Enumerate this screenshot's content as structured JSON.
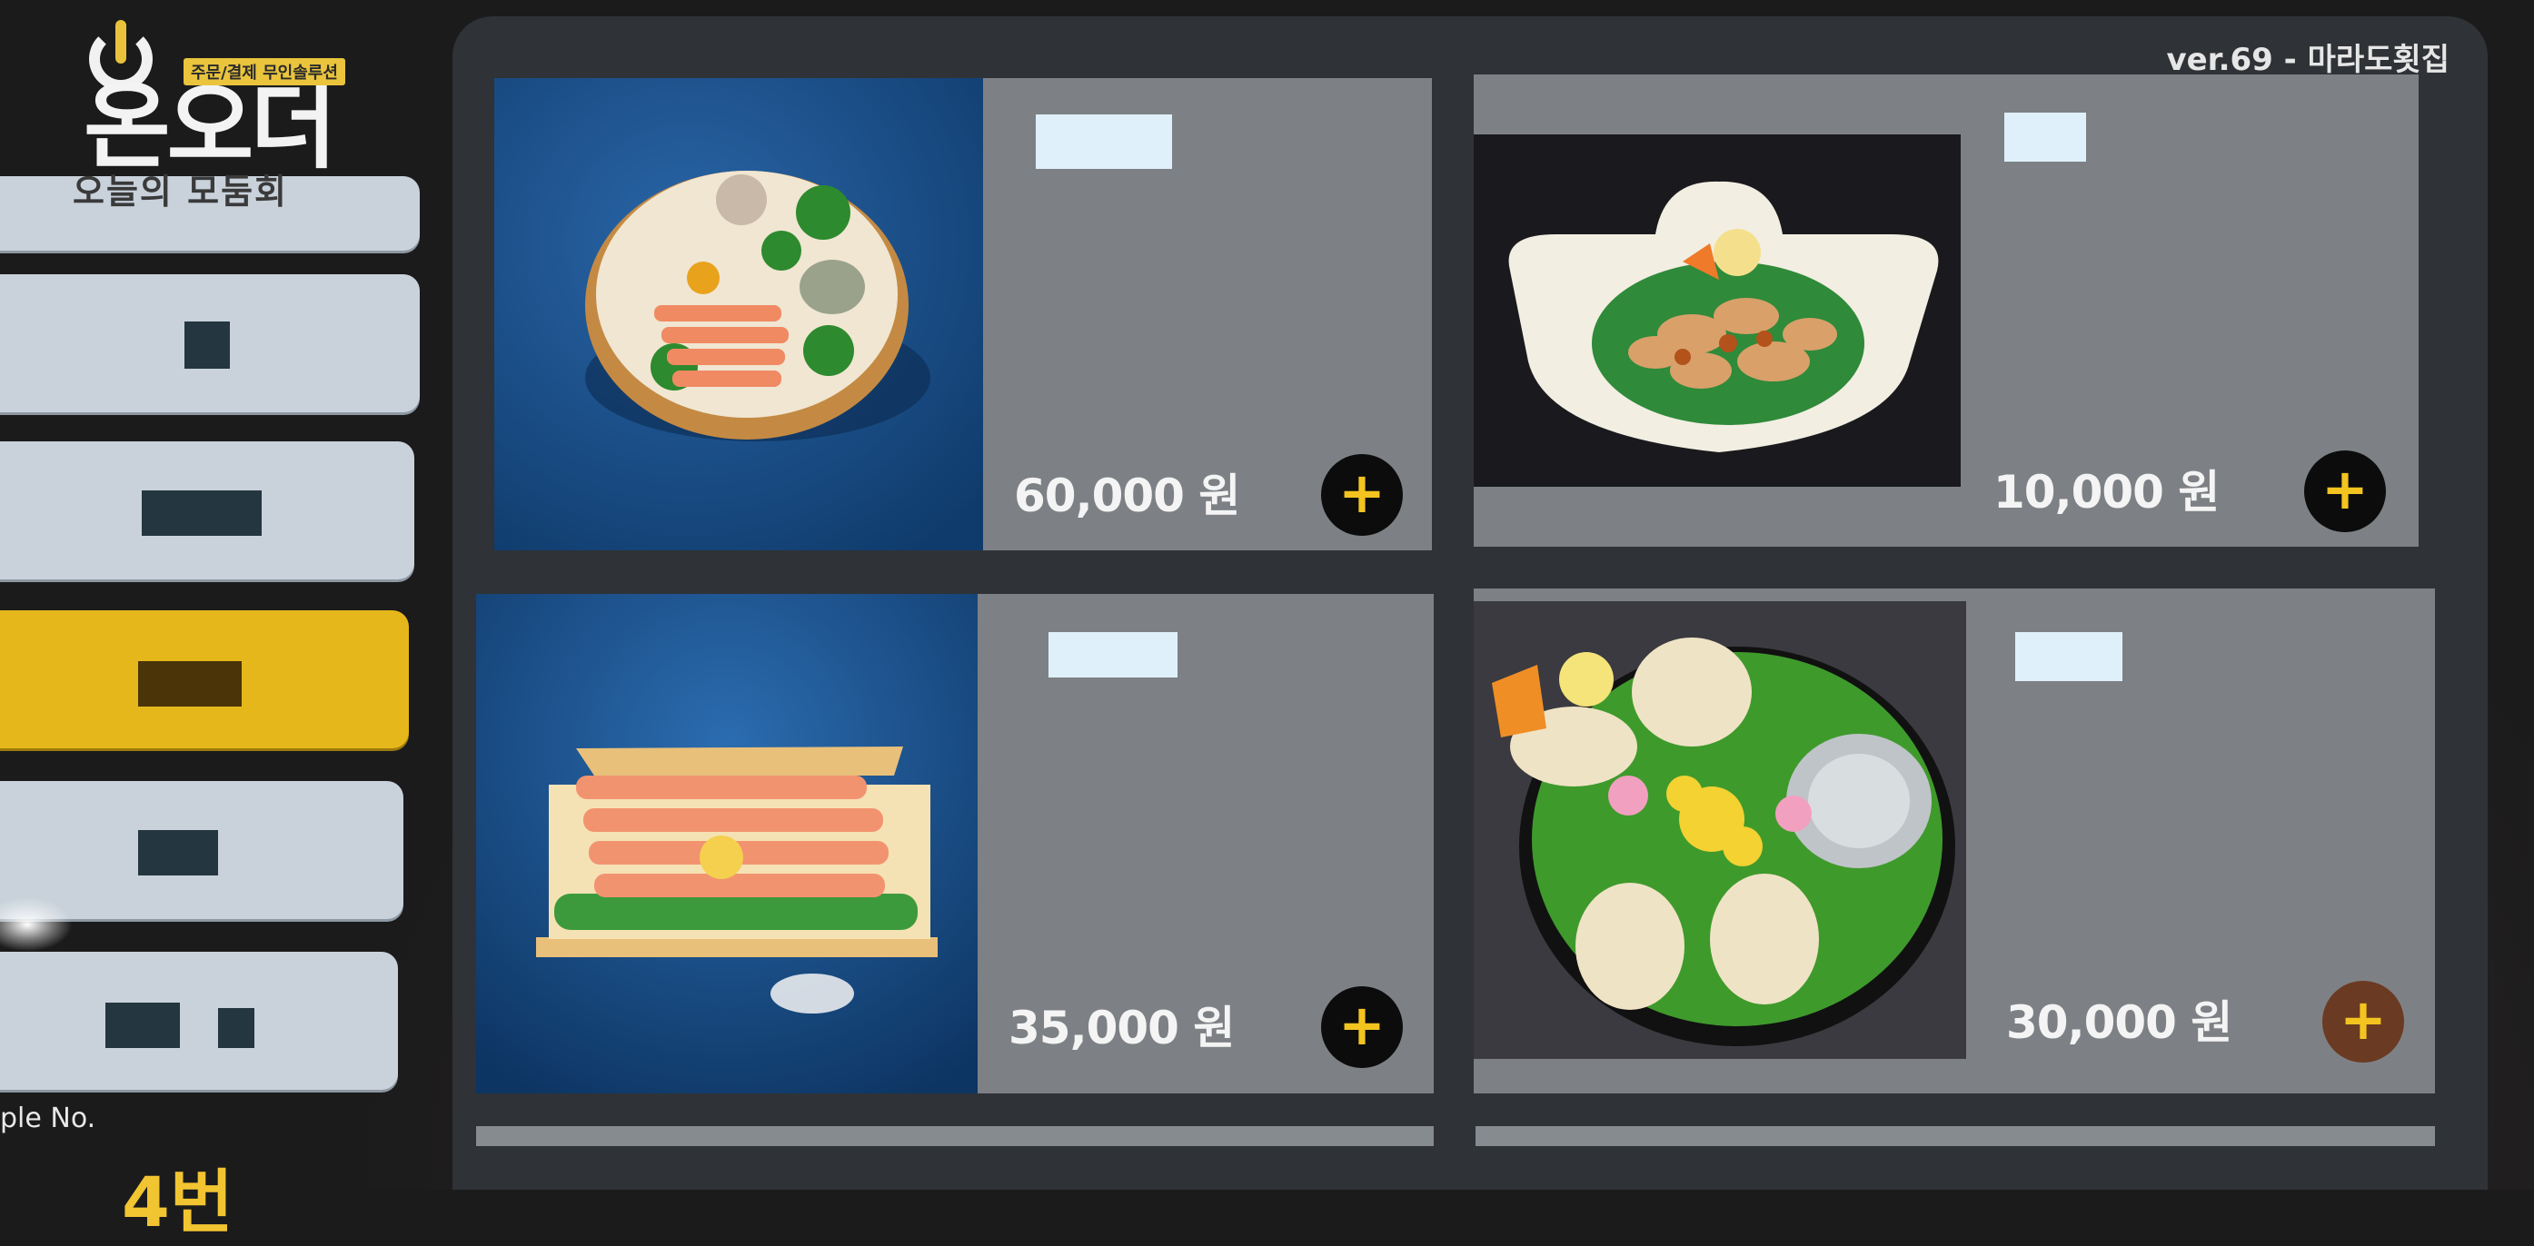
{
  "app": {
    "logo_text": "온오더",
    "logo_tag": "주문/결제 무인솔루션",
    "version_label": "ver.69 - 마라도횟집"
  },
  "sidebar": {
    "first_item_label": "오늘의 모둠회",
    "items": [
      {
        "label": "",
        "state": "normal"
      },
      {
        "label": "",
        "state": "normal"
      },
      {
        "label": "",
        "state": "selected"
      },
      {
        "label": "",
        "state": "normal"
      },
      {
        "label": "",
        "state": "normal"
      }
    ],
    "table_label": "ple No.",
    "table_number": "4번"
  },
  "menu": {
    "items": [
      {
        "name": "",
        "price": "60,000 원",
        "add_icon": "plus-icon"
      },
      {
        "name": "",
        "price": "10,000 원",
        "add_icon": "plus-icon"
      },
      {
        "name": "",
        "price": "35,000 원",
        "add_icon": "plus-icon"
      },
      {
        "name": "",
        "price": "30,000 원",
        "add_icon": "plus-icon"
      }
    ]
  },
  "colors": {
    "accent": "#e5b71b",
    "card": "#7d8185",
    "panel": "#2f3236",
    "sidebar_button": "#c9d2db",
    "plus": "#f3c41f"
  }
}
